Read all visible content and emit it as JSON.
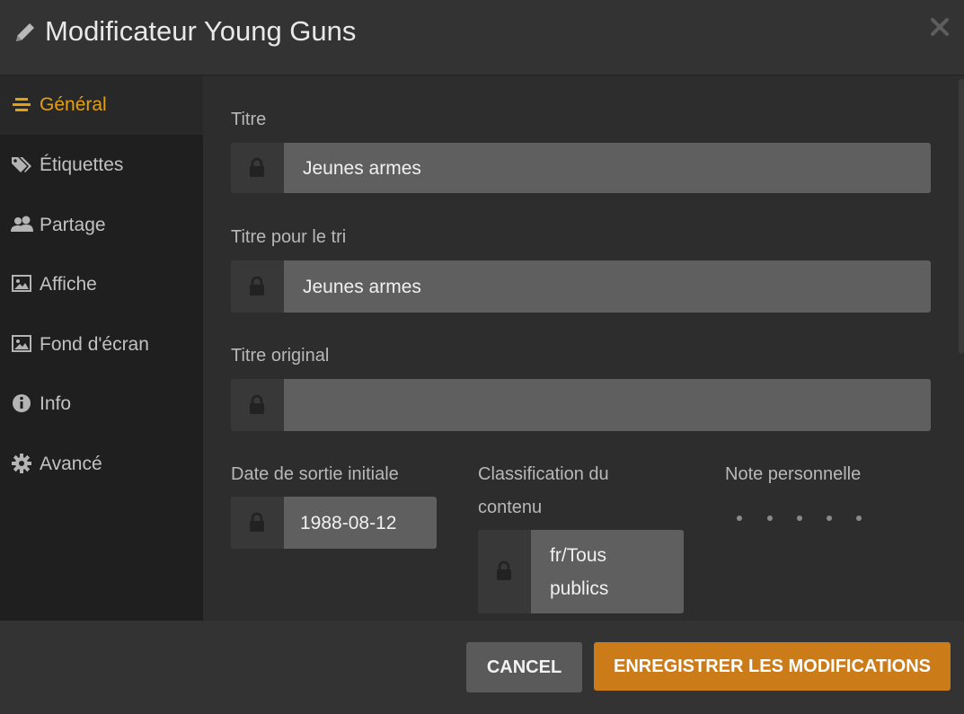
{
  "header": {
    "title": "Modificateur Young Guns"
  },
  "sidebar": {
    "items": [
      {
        "label": "Général",
        "icon": "list-icon",
        "active": true
      },
      {
        "label": "Étiquettes",
        "icon": "tags-icon",
        "active": false
      },
      {
        "label": "Partage",
        "icon": "users-icon",
        "active": false
      },
      {
        "label": "Affiche",
        "icon": "image-icon",
        "active": false
      },
      {
        "label": "Fond d'écran",
        "icon": "image-icon",
        "active": false
      },
      {
        "label": "Info",
        "icon": "info-icon",
        "active": false
      },
      {
        "label": "Avancé",
        "icon": "gear-icon",
        "active": false
      }
    ]
  },
  "form": {
    "title": {
      "label": "Titre",
      "value": "Jeunes armes"
    },
    "sort_title": {
      "label": "Titre pour le tri",
      "value": "Jeunes armes"
    },
    "original_title": {
      "label": "Titre original",
      "value": ""
    },
    "release_date": {
      "label": "Date de sortie initiale",
      "value": "1988-08-12"
    },
    "content_rating": {
      "label_line1": "Classification du",
      "label_line2": "contenu",
      "value_line1": "fr/Tous",
      "value_line2": "publics"
    },
    "user_rating": {
      "label": "Note personnelle",
      "stars": 5,
      "value": 0
    }
  },
  "footer": {
    "cancel_label": "CANCEL",
    "save_label": "ENREGISTRER LES MODIFICATIONS"
  },
  "colors": {
    "accent": "#e5a00d",
    "save_button": "#cc7b19"
  }
}
